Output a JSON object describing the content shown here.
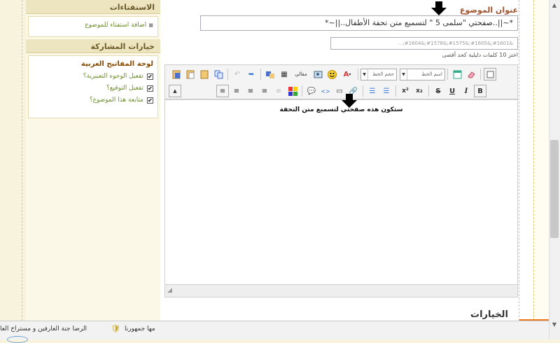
{
  "colors": {
    "accent_title": "#a0522d",
    "link_green": "#6c8f2b",
    "sidebar_bg": "#fbf8e7"
  },
  "sidebar": {
    "polls_header": "الاستفتاءات",
    "add_poll_link": "اضافة استفتاء للموضوع",
    "options_header": "خيارات المشاركة",
    "keyboard_title": "لوحة المفاتيح العربية",
    "checkboxes": [
      {
        "label": "تفعيل الوجوه التعبيرية؟",
        "checked": true
      },
      {
        "label": "تفعيل التوقيع؟",
        "checked": true
      },
      {
        "label": "متابعة هذا الموضوع؟",
        "checked": true
      }
    ]
  },
  "main": {
    "subject_label": "عنوان الموضوع",
    "subject_value": "*~||..صفحتي  \"سلمى 5 \"  لتسميع متن تحفة الأطفال..||~*",
    "tags_value": "&#1601;&#1605;&#1575;&#1578;&#1604;...",
    "tags_hint": "اختر 10 كلمات دليلية كحد أقصى",
    "font_size_placeholder": "حجم الخط",
    "font_name_placeholder": "اسم الخط",
    "article_label": "مقالي",
    "editor_text": "ستكون هذه صفحتي لتسميع متن التحفة",
    "options_title": "الخيارات"
  },
  "icons": {
    "paste": "paste-icon",
    "undo": "undo-icon",
    "redo": "redo-icon",
    "bold": "bold-icon",
    "italic": "italic-icon",
    "underline": "underline-icon",
    "strike": "strike-icon",
    "smiley": "smiley-icon",
    "arrow": "pointer-arrow-icon"
  },
  "bottom_bar": {
    "item1": "الرضا جنة العارفين و مستراح العا",
    "item2": "مها جمهورنا"
  }
}
